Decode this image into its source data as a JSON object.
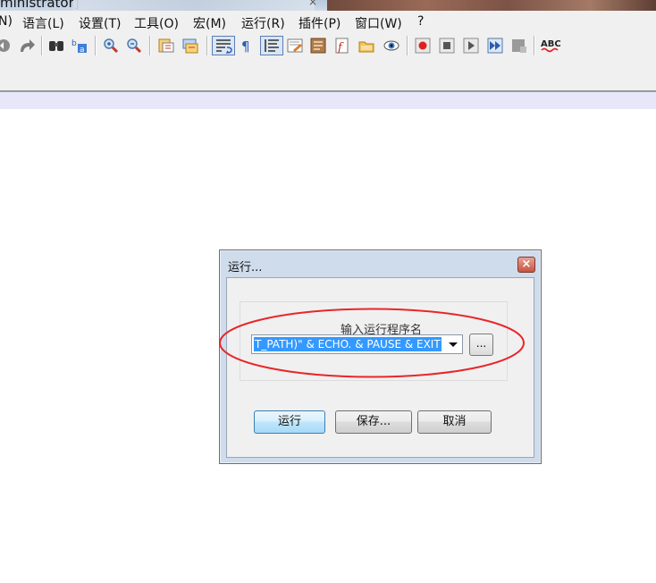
{
  "window": {
    "title_fragment": "ministrator]",
    "close_glyph": "×"
  },
  "menu": [
    {
      "label": "N)"
    },
    {
      "label": "语言(L)"
    },
    {
      "label": "设置(T)"
    },
    {
      "label": "工具(O)"
    },
    {
      "label": "宏(M)"
    },
    {
      "label": "运行(R)"
    },
    {
      "label": "插件(P)"
    },
    {
      "label": "窗口(W)"
    },
    {
      "label": "?"
    }
  ],
  "toolbar": {
    "icons": [
      "undo-icon",
      "redo-icon",
      "find-icon",
      "replace-icon",
      "zoom-in-icon",
      "zoom-out-icon",
      "sync-vertical-icon",
      "sync-horizontal-icon",
      "word-wrap-icon",
      "show-all-chars-icon",
      "indent-guide-icon",
      "user-define-icon",
      "function-list-icon",
      "folder-workspace-icon",
      "document-map-icon",
      "monitoring-icon",
      "record-macro-icon",
      "stop-record-icon",
      "playback-icon",
      "run-macro-multiple-icon",
      "save-macro-icon",
      "spell-check-icon"
    ],
    "spellcheck_label": "ABC"
  },
  "dialog": {
    "title": "运行...",
    "close_glyph": "×",
    "prompt": "输入运行程序名",
    "command_value": "T_PATH)\" & ECHO. & PAUSE & EXIT",
    "browse_label": "...",
    "run_label": "运行",
    "save_label": "保存...",
    "cancel_label": "取消"
  },
  "colors": {
    "annotation": "#e8262a",
    "selection": "#3399ff"
  }
}
